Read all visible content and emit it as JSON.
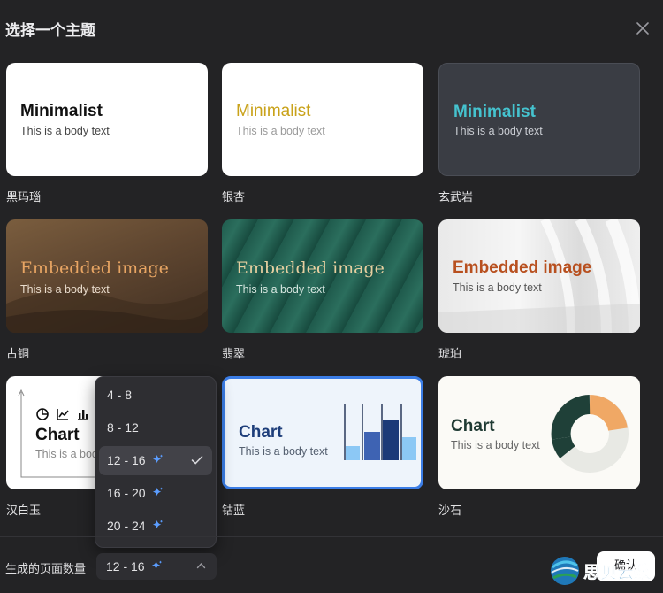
{
  "header": {
    "title": "选择一个主题"
  },
  "themes": [
    {
      "name": "黑玛瑙",
      "title": "Minimalist",
      "body": "This is a body text",
      "title_color": "#111111",
      "body_color": "#444444"
    },
    {
      "name": "银杏",
      "title": "Minimalist",
      "body": "This is a body text",
      "title_color": "#c9a21a",
      "body_color": "#9a9a9a"
    },
    {
      "name": "玄武岩",
      "title": "Minimalist",
      "body": "This is a body text",
      "title_color": "#45c3cf",
      "body_color": "#c9ccd2"
    },
    {
      "name": "古铜",
      "title": "Embedded image",
      "body": "This is a body text",
      "title_color": "#e8a563",
      "body_color": "#e9dccd"
    },
    {
      "name": "翡翠",
      "title": "Embedded image",
      "body": "This is a body text",
      "title_color": "#e6cfa0",
      "body_color": "#d5e6df"
    },
    {
      "name": "琥珀",
      "title": "Embedded image",
      "body": "This is a body text",
      "title_color": "#b8501f",
      "body_color": "#555555"
    },
    {
      "name": "汉白玉",
      "title": "Chart",
      "body": "This is a body text",
      "title_color": "#111111",
      "body_color": "#888888"
    },
    {
      "name": "钴蓝",
      "title": "Chart",
      "body": "This is a body text",
      "title_color": "#1e3e7a",
      "body_color": "#556070"
    },
    {
      "name": "沙石",
      "title": "Chart",
      "body": "This is a body text",
      "title_color": "#1f3a33",
      "body_color": "#666666"
    }
  ],
  "selected_theme": "钴蓝",
  "dropdown": {
    "options": [
      {
        "label": "4 - 8",
        "ai": false
      },
      {
        "label": "8 - 12",
        "ai": false
      },
      {
        "label": "12 - 16",
        "ai": true
      },
      {
        "label": "16 - 20",
        "ai": true
      },
      {
        "label": "20 - 24",
        "ai": true
      }
    ],
    "selected": "12 - 16"
  },
  "footer": {
    "page_count_label": "生成的页面数量",
    "page_count_value": "12 - 16",
    "confirm_label": "确认"
  },
  "watermark": {
    "text": "思贝云数"
  },
  "colors": {
    "accent": "#3b7de6",
    "background": "#232325",
    "sparkle": "#5b9dff"
  }
}
